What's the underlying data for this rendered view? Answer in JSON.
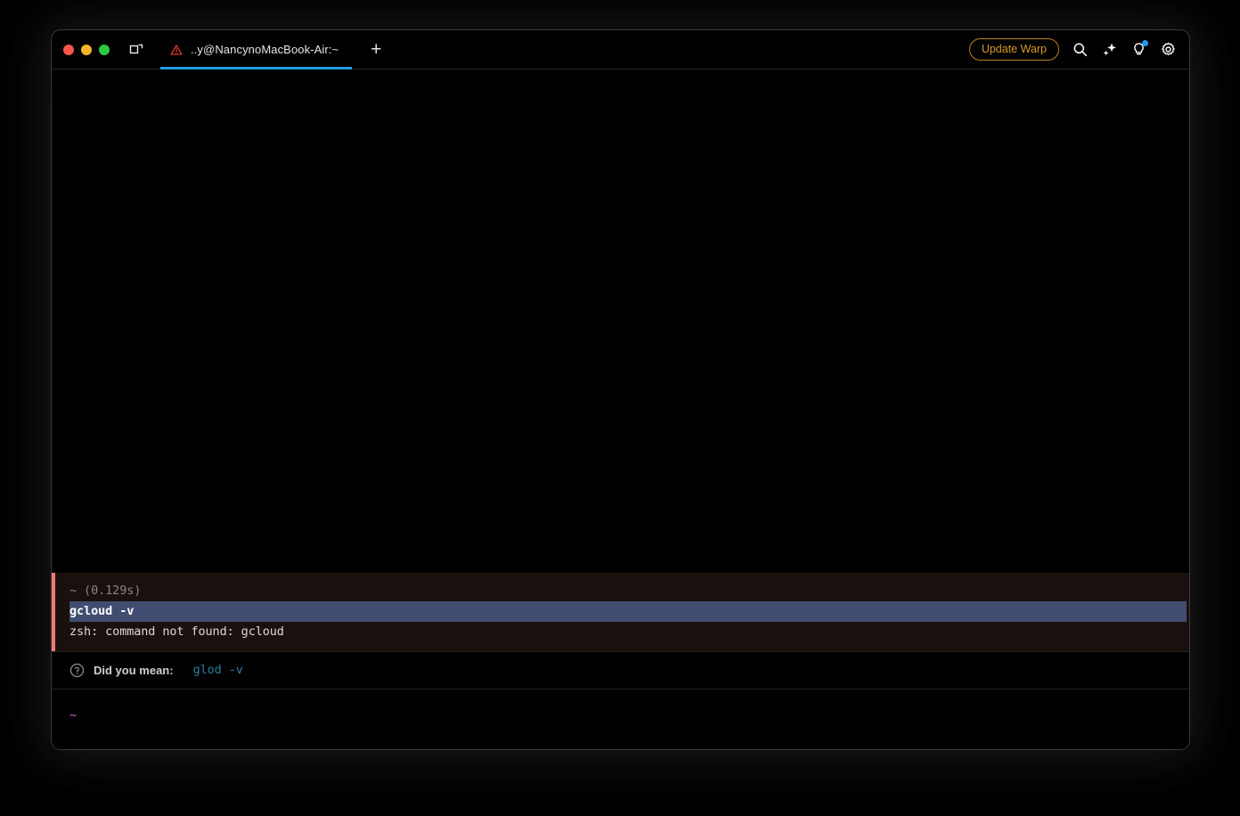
{
  "window": {
    "traffic_lights": [
      "close",
      "minimize",
      "maximize"
    ],
    "panel_icon": "split-panel-icon"
  },
  "titlebar": {
    "tab": {
      "warning_icon": "warning-triangle-icon",
      "title": "..y@NancynoMacBook-Air:~",
      "active": true
    },
    "new_tab_label": "+",
    "update_button": "Update Warp",
    "icons": [
      {
        "name": "search-icon",
        "badge": false
      },
      {
        "name": "sparkle-ai-icon",
        "badge": false
      },
      {
        "name": "lightbulb-icon",
        "badge": true
      },
      {
        "name": "gear-icon",
        "badge": false
      }
    ]
  },
  "terminal": {
    "block": {
      "prompt_meta": "~ (0.129s)",
      "command": "gcloud -v",
      "output": "zsh: command not found: gcloud",
      "accent_color": "#ef7a6c",
      "background_color": "#1a100e",
      "selection_color": "#404d70"
    },
    "suggestion": {
      "icon": "question-circle-icon",
      "label": "Did you mean:",
      "command": "glod -v",
      "command_color": "#2b7f9e"
    },
    "input": {
      "prompt": "~",
      "prompt_color": "#e05fd0",
      "value": ""
    }
  }
}
